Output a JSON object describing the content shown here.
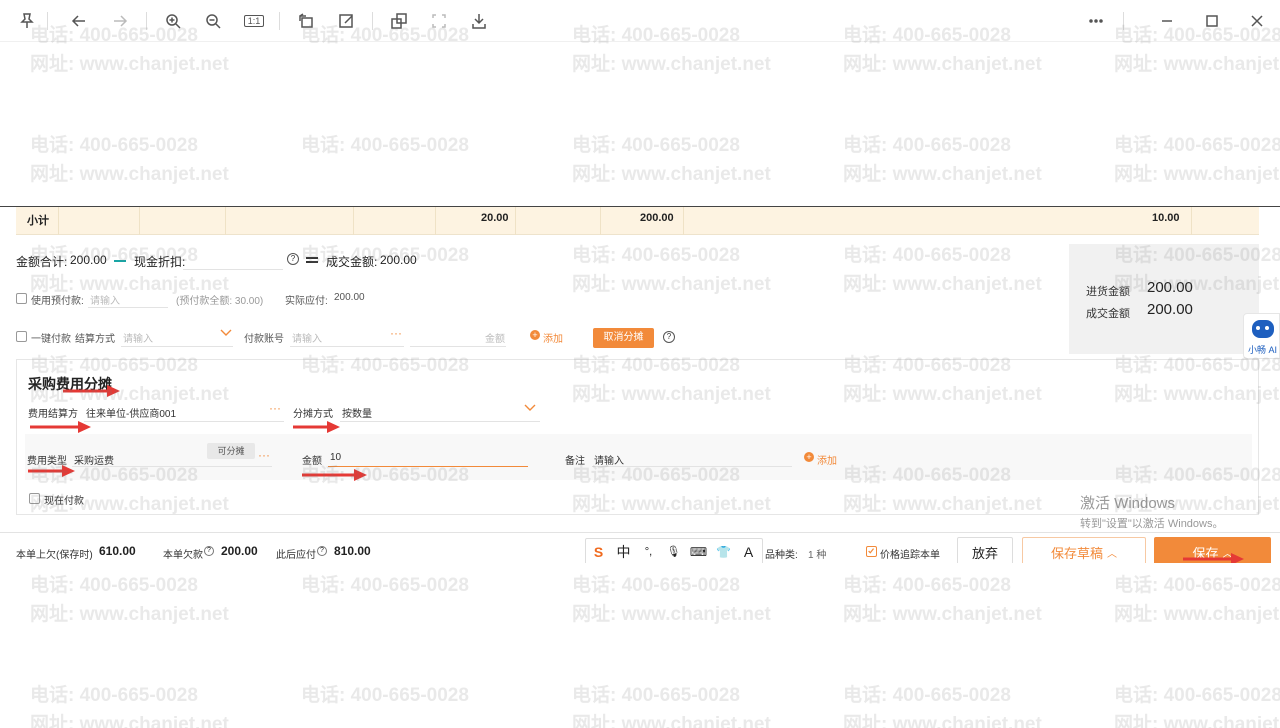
{
  "watermark": {
    "phone": "电话: 400-665-0028",
    "site": "网址: www.chanjet.net"
  },
  "viewer": {
    "pin_icon": "pin-icon",
    "actual_size_label": "1:1",
    "more_icon": "ellipsis-icon"
  },
  "subtotal": {
    "label": "小计",
    "qty": "20.00",
    "amount": "200.00",
    "total": "10.00"
  },
  "summary": {
    "amount_total_label": "金额合计:",
    "amount_total": "200.00",
    "cash_discount_label": "现金折扣:",
    "deal_amount_label": "成交金额:",
    "deal_amount": "200.00",
    "use_prepay_label": "使用预付款:",
    "prepay_placeholder": "请输入",
    "prepay_total": "(预付款全额: 30.00)",
    "actual_pay_label": "实际应付:",
    "actual_pay": "200.00",
    "one_click_pay_label": "一键付款",
    "settle_method_label": "结算方式",
    "settle_placeholder": "请输入",
    "pay_account_label": "付款账号",
    "pay_account_placeholder": "请输入",
    "amount_placeholder": "金额",
    "add_label": "添加",
    "cancel_alloc_label": "取消分摊"
  },
  "right_panel": {
    "purchase_amount_label": "进货金额",
    "purchase_amount": "200.00",
    "deal_amount_label": "成交金额",
    "deal_amount": "200.00"
  },
  "robot": {
    "label": "小畅 AI"
  },
  "allocation": {
    "title": "采购费用分摊",
    "settle_party_label": "费用结算方",
    "settle_party_value": "往来单位-供应商001",
    "method_label": "分摊方式",
    "method_value": "按数量",
    "fee_type_label": "费用类型",
    "fee_type_value": "采购运费",
    "allocatable_label": "可分摊",
    "amount_label": "金额",
    "amount_value": "10",
    "remark_label": "备注",
    "remark_placeholder": "请输入",
    "add_label": "添加",
    "pay_now_label": "现在付款"
  },
  "activate_windows": {
    "title": "激活 Windows",
    "subtitle": "转到\"设置\"以激活 Windows。"
  },
  "footer": {
    "prev_debt_label": "本单上欠(保存时)",
    "prev_debt": "610.00",
    "this_debt_label": "本单欠款",
    "this_debt": "200.00",
    "after_pay_label": "此后应付",
    "after_pay": "810.00",
    "ime_chars": [
      "中",
      "°,",
      "🎙",
      "⌨",
      "👕",
      "A"
    ],
    "kinds_label": "品种类:",
    "kinds_value": "1 种",
    "price_track_label": "价格追踪本单",
    "discard_label": "放弃",
    "save_draft_label": "保存草稿",
    "save_label": "保存"
  },
  "colors": {
    "accent": "#f28a3a",
    "subtotal_bg": "#fdf3e1",
    "arrow": "#e53935"
  }
}
